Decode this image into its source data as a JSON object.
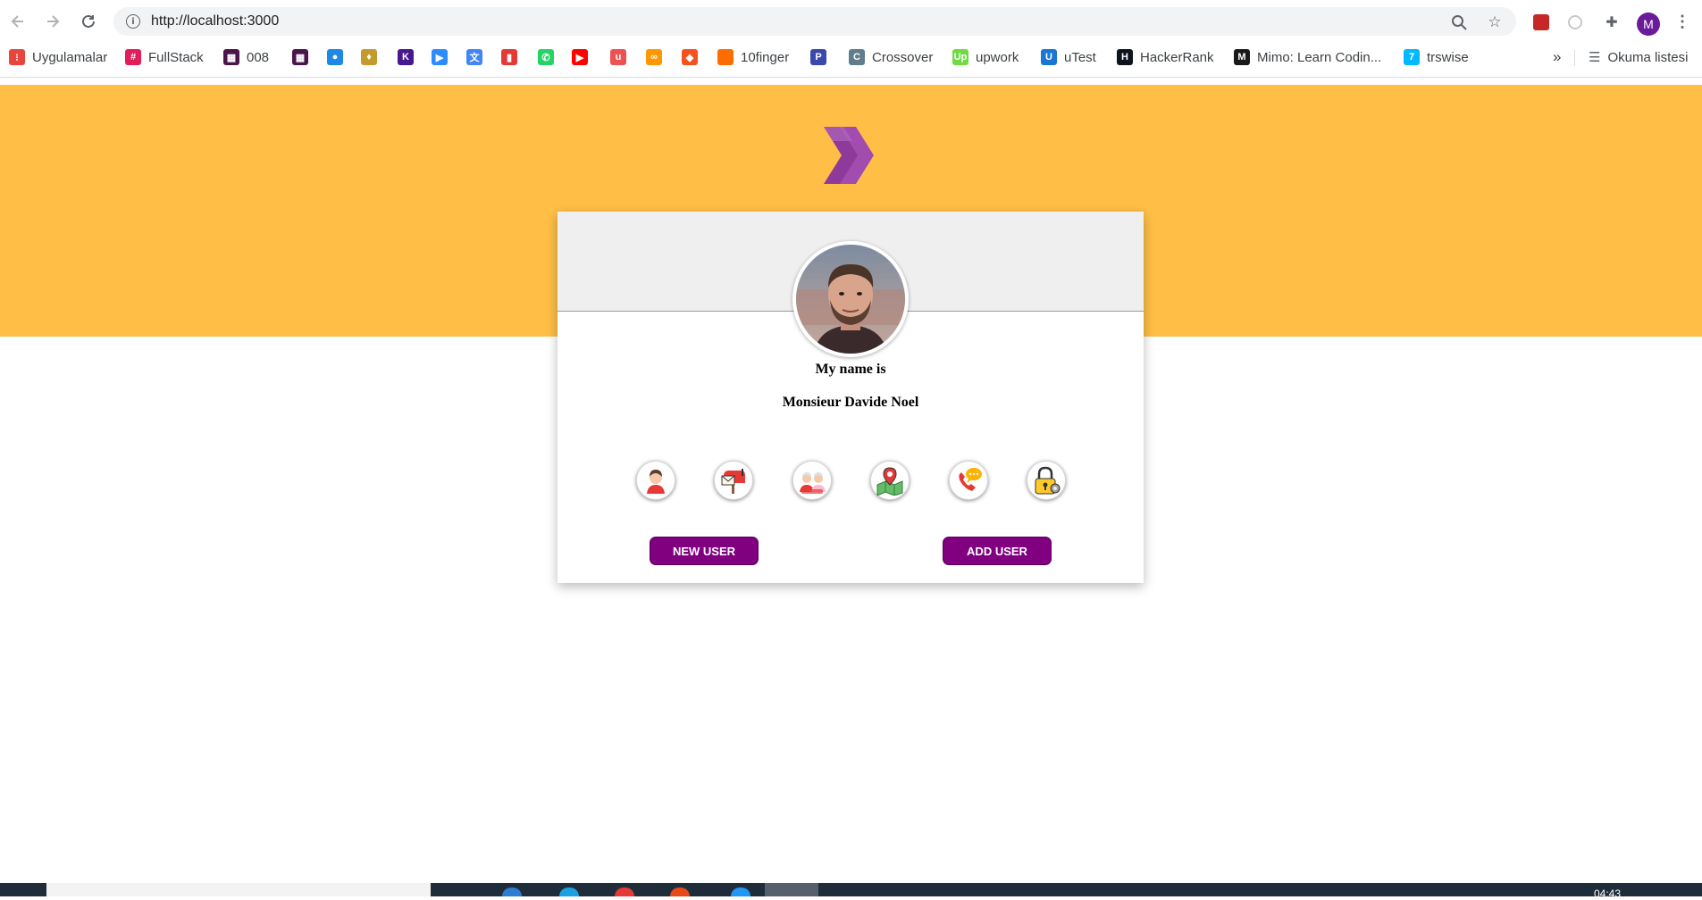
{
  "browser": {
    "url": "http://localhost:3000",
    "profile_initial": "M",
    "bookmarks": [
      {
        "label": "Uygulamalar",
        "icon": "apps-grid-icon",
        "color": "#e8453c"
      },
      {
        "label": "FullStack",
        "icon": "slack-icon",
        "color": "#e01e5a"
      },
      {
        "label": "008",
        "icon": "grid-icon",
        "color": "#4a154b"
      },
      {
        "label": "",
        "icon": "grid-icon",
        "color": "#4a154b"
      },
      {
        "label": "",
        "icon": "circle-icon",
        "color": "#1e88e5"
      },
      {
        "label": "",
        "icon": "pear-icon",
        "color": "#c49a2c"
      },
      {
        "label": "",
        "icon": "kahoot-icon",
        "color": "#46178f"
      },
      {
        "label": "",
        "icon": "zoom-icon",
        "color": "#2d8cff"
      },
      {
        "label": "",
        "icon": "translate-icon",
        "color": "#4285f4"
      },
      {
        "label": "",
        "icon": "book-icon",
        "color": "#e53935"
      },
      {
        "label": "",
        "icon": "whatsapp-icon",
        "color": "#25d366"
      },
      {
        "label": "",
        "icon": "youtube-icon",
        "color": "#ff0000"
      },
      {
        "label": "",
        "icon": "udemy-icon",
        "color": "#ec5252"
      },
      {
        "label": "",
        "icon": "infinity-icon",
        "color": "#ff9800"
      },
      {
        "label": "",
        "icon": "diamond-icon",
        "color": "#f4511e"
      },
      {
        "label": "10finger",
        "icon": "square-icon",
        "color": "#ff6d00"
      },
      {
        "label": "",
        "icon": "p-icon",
        "color": "#3949ab"
      },
      {
        "label": "Crossover",
        "icon": "c-icon",
        "color": "#607d8b"
      },
      {
        "label": "upwork",
        "icon": "upwork-icon",
        "color": "#6fda44"
      },
      {
        "label": "uTest",
        "icon": "u-icon",
        "color": "#1976d2"
      },
      {
        "label": "HackerRank",
        "icon": "hackerrank-icon",
        "color": "#0e141e"
      },
      {
        "label": "Mimo: Learn Codin...",
        "icon": "mimo-icon",
        "color": "#1a1a1a"
      },
      {
        "label": "trswise",
        "icon": "wise-icon",
        "color": "#00b9ff"
      }
    ],
    "overflow_label": "»",
    "reading_list_label": "Okuma listesi"
  },
  "profile_card": {
    "intro_label": "My name is",
    "name_value": "Monsieur Davide Noel",
    "info_icons": [
      "user-icon",
      "mailbox-icon",
      "age-icon",
      "map-icon",
      "phone-icon",
      "lock-icon"
    ],
    "new_user_label": "NEW USER",
    "add_user_label": "ADD USER"
  },
  "taskbar": {
    "clock": "04:43"
  },
  "colors": {
    "banner": "#ffbf47",
    "button": "#800080",
    "logo": "#9b3fa6",
    "card_header": "#f0eff0"
  }
}
